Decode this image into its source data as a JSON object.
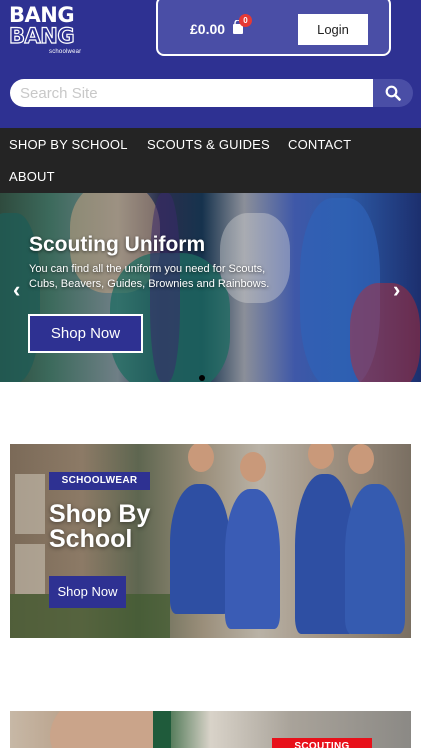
{
  "header": {
    "logo": {
      "line1": "BANG",
      "line2": "BANG",
      "line3": "schoolwear"
    },
    "cart": {
      "total": "£0.00",
      "count": "0",
      "icon": "shopping-bag-icon"
    },
    "login_label": "Login",
    "search": {
      "placeholder": "Search Site",
      "value": "",
      "icon": "search-icon"
    }
  },
  "nav": {
    "items": [
      "SHOP BY SCHOOL",
      "SCOUTS & GUIDES",
      "CONTACT",
      "ABOUT"
    ]
  },
  "hero": {
    "title": "Scouting Uniform",
    "text": "You can find all the uniform you need for Scouts, Cubs, Beavers, Guides, Brownies and Rainbows.",
    "button_label": "Shop Now",
    "prev_arrow": "‹",
    "next_arrow": "›"
  },
  "promo_school": {
    "tag": "SCHOOLWEAR",
    "title": "Shop By School",
    "button_label": "Shop Now"
  },
  "promo_scouting": {
    "tag": "SCOUTING"
  },
  "colors": {
    "brand_blue": "#2e3192",
    "nav_dark": "#242424",
    "badge_red": "#e53935",
    "scouting_red": "#e8101a"
  }
}
